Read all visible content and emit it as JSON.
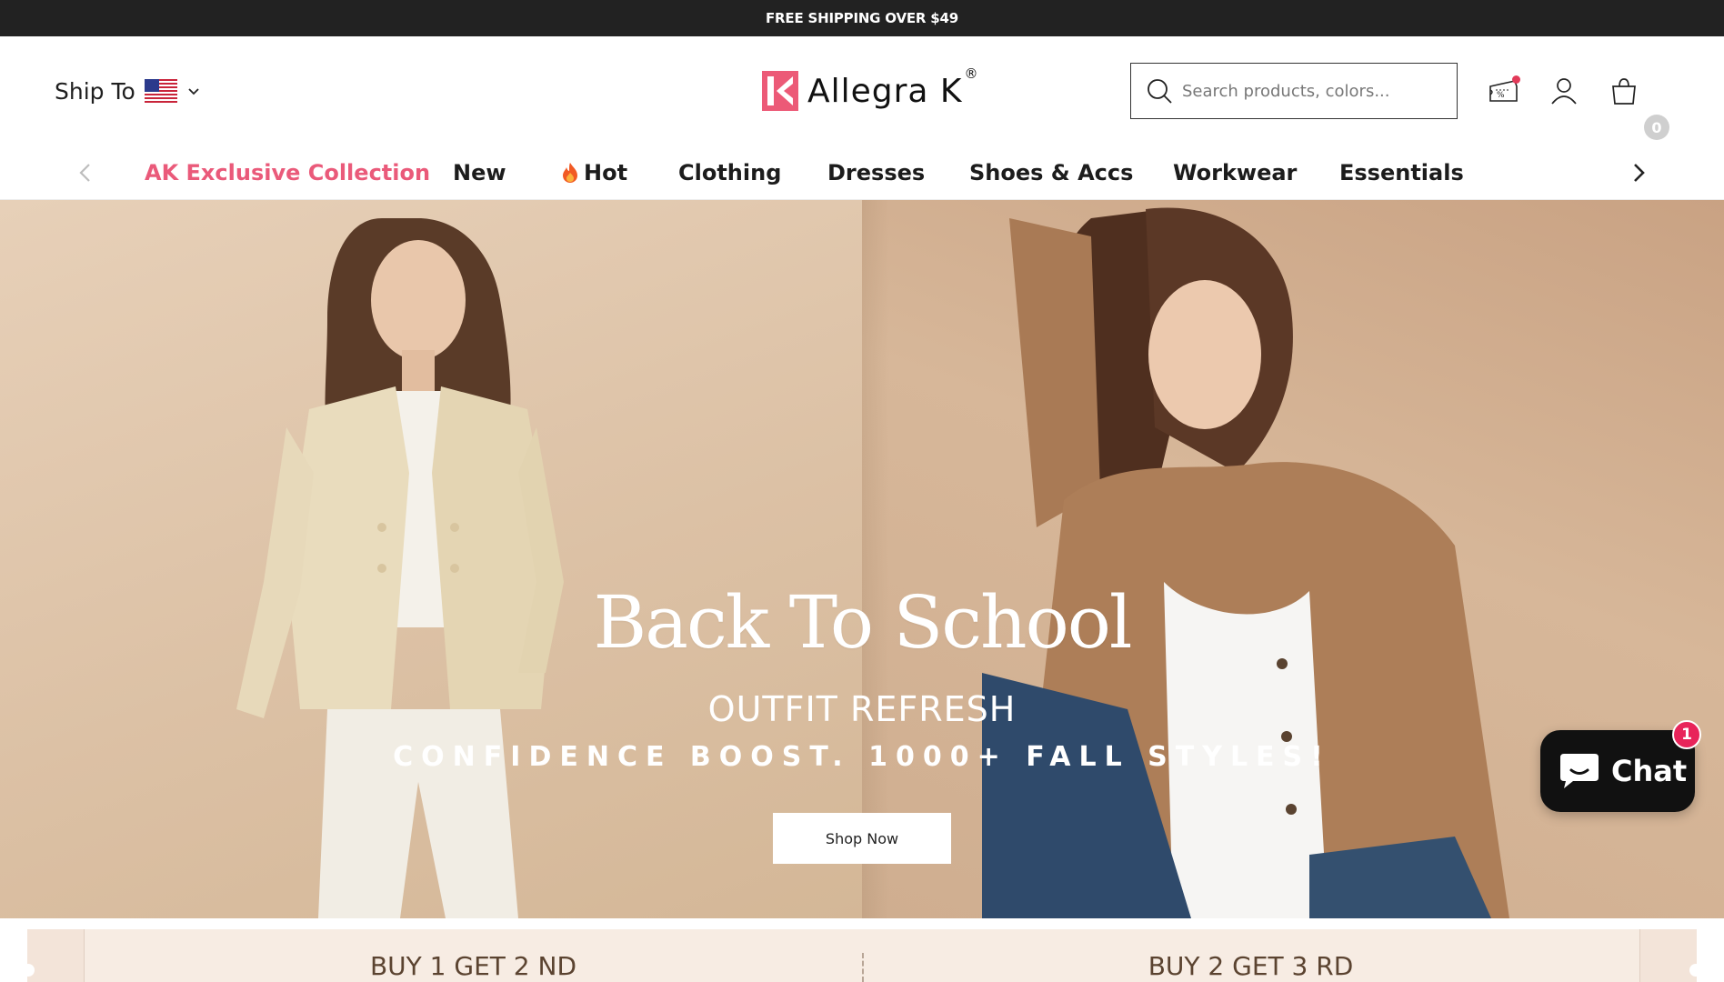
{
  "announcement": {
    "text": "FREE SHIPPING OVER $49"
  },
  "header": {
    "ship_to_label": "Ship To",
    "flag": "us-flag",
    "logo_text": "Allegra K",
    "logo_reg": "®",
    "search_placeholder": "Search products, colors...",
    "cart_count": "0"
  },
  "nav": {
    "items": [
      {
        "label": "AK Exclusive Collection"
      },
      {
        "label": "New"
      },
      {
        "label": "Hot"
      },
      {
        "label": "Clothing"
      },
      {
        "label": "Dresses"
      },
      {
        "label": "Shoes & Accs"
      },
      {
        "label": "Workwear"
      },
      {
        "label": "Essentials"
      }
    ]
  },
  "hero": {
    "title": "Back To School",
    "subtitle": "OUTFIT REFRESH",
    "tagline": "CONFIDENCE BOOST. 1000+  FALL STYLES!",
    "cta_label": "Shop Now"
  },
  "chat": {
    "label": "Chat",
    "badge": "1"
  },
  "promo": {
    "cards": [
      {
        "label": "BUY 1 GET 2 ND"
      },
      {
        "label": "BUY 2 GET 3 RD"
      }
    ]
  },
  "colors": {
    "accent": "#ea5a7a",
    "announcement_bg": "#222222",
    "chat_bg": "#111111",
    "badge": "#e8245a"
  }
}
